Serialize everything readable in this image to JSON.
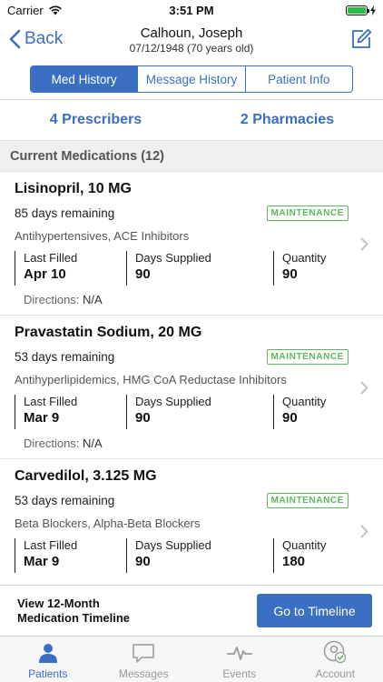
{
  "status_bar": {
    "carrier": "Carrier",
    "time": "3:51 PM"
  },
  "nav": {
    "back_label": "Back",
    "patient_name": "Calhoun, Joseph",
    "patient_dob": "07/12/1948 (70 years old)"
  },
  "tabs": [
    "Med History",
    "Message History",
    "Patient Info"
  ],
  "summary": {
    "prescribers": "4 Prescribers",
    "pharmacies": "2 Pharmacies"
  },
  "section_title": "Current Medications (12)",
  "medications": [
    {
      "name": "Lisinopril, 10 MG",
      "days_remaining": "85 days remaining",
      "badge": "MAINTENANCE",
      "class": "Antihypertensives, ACE Inhibitors",
      "last_filled_label": "Last Filled",
      "last_filled": "Apr 10",
      "days_supplied_label": "Days Supplied",
      "days_supplied": "90",
      "quantity_label": "Quantity",
      "quantity": "90",
      "directions_label": "Directions:",
      "directions": "N/A"
    },
    {
      "name": "Pravastatin Sodium, 20 MG",
      "days_remaining": "53 days remaining",
      "badge": "MAINTENANCE",
      "class": "Antihyperlipidemics, HMG CoA Reductase Inhibitors",
      "last_filled_label": "Last Filled",
      "last_filled": "Mar 9",
      "days_supplied_label": "Days Supplied",
      "days_supplied": "90",
      "quantity_label": "Quantity",
      "quantity": "90",
      "directions_label": "Directions:",
      "directions": "N/A"
    },
    {
      "name": "Carvedilol, 3.125 MG",
      "days_remaining": "53 days remaining",
      "badge": "MAINTENANCE",
      "class": "Beta Blockers, Alpha-Beta Blockers",
      "last_filled_label": "Last Filled",
      "last_filled": "Mar 9",
      "days_supplied_label": "Days Supplied",
      "days_supplied": "90",
      "quantity_label": "Quantity",
      "quantity": "180"
    }
  ],
  "timeline": {
    "text_line1": "View 12-Month",
    "text_line2": "Medication Timeline",
    "button": "Go to Timeline"
  },
  "tab_bar": [
    "Patients",
    "Messages",
    "Events",
    "Account"
  ],
  "colors": {
    "accent": "#3b6fc4",
    "badge_green": "#5cb85c"
  }
}
